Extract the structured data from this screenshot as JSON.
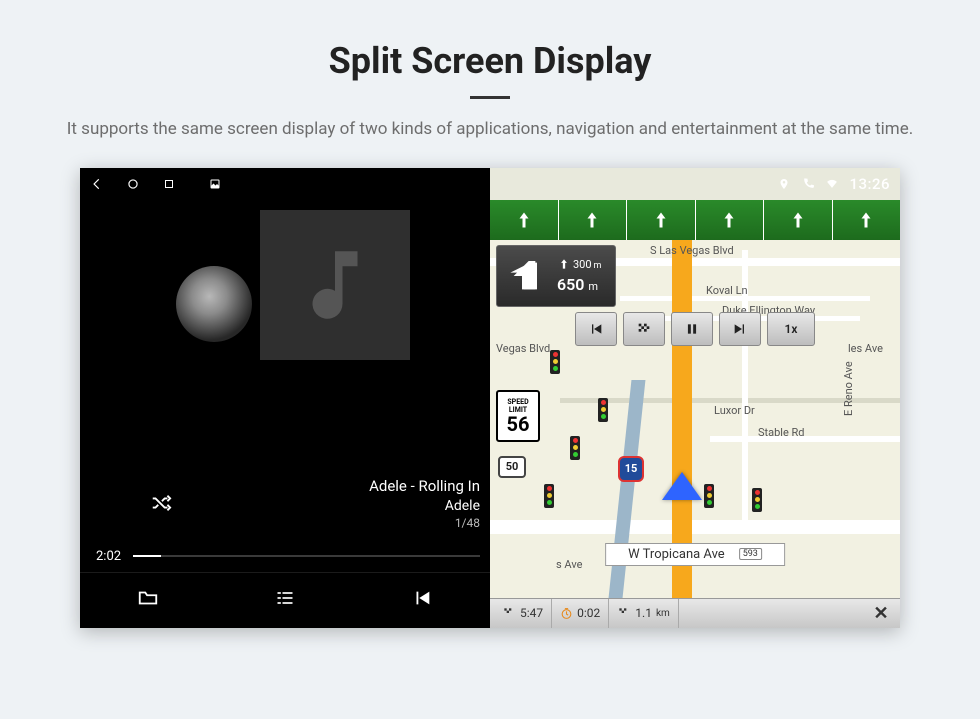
{
  "header": {
    "title": "Split Screen Display",
    "subtitle": "It supports the same screen display of two kinds of applications, navigation and entertainment at the same time."
  },
  "status": {
    "clock": "13:26",
    "icons_left": [
      "back-icon",
      "home-icon",
      "recents-icon",
      "image-icon"
    ],
    "icons_right": [
      "location-icon",
      "phone-icon",
      "wifi-icon"
    ]
  },
  "music": {
    "track_title": "Adele - Rolling In",
    "artist": "Adele",
    "track_counter": "1/48",
    "elapsed": "2:02",
    "controls": {
      "folder": "Folder",
      "list": "List",
      "prev": "Previous"
    }
  },
  "nav": {
    "turn": {
      "next_dist": "300",
      "next_unit": "m",
      "primary_dist": "650",
      "primary_unit": "m"
    },
    "lanes": 6,
    "transport": {
      "prev": "prev",
      "pause": "pause",
      "next": "next",
      "speed": "1x"
    },
    "speed_limit": {
      "label_top": "SPEED",
      "label_mid": "LIMIT",
      "value": "56"
    },
    "shields": {
      "us50": "50",
      "i15": "15"
    },
    "streets": {
      "s_las_vegas": "S Las Vegas Blvd",
      "koval": "Koval Ln",
      "duke": "Duke Ellington Way",
      "vegas_blvd_w": "Vegas Blvd",
      "luxor": "Luxor Dr",
      "stable": "Stable Rd",
      "e_reno": "E Reno Ave",
      "tropicana": "W Tropicana Ave",
      "tropicana_badge": "593",
      "elvis": "s Ave",
      "les": "les Ave"
    },
    "bottom": {
      "eta": "5:47",
      "countdown": "0:02",
      "remaining_dist": "1.1",
      "remaining_unit": "km"
    }
  }
}
